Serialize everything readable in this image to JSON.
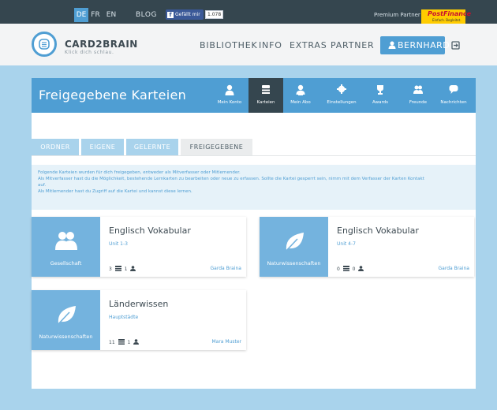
{
  "topbar": {
    "languages": [
      {
        "code": "DE",
        "active": true
      },
      {
        "code": "FR",
        "active": false
      },
      {
        "code": "EN",
        "active": false
      }
    ],
    "blog_label": "BLOG",
    "facebook": {
      "label": "Gefällt mir",
      "count": "1.078"
    },
    "premium_partner_label": "Premium Partner",
    "sponsor": {
      "name": "PostFinance",
      "tagline": "Einfach. Begleitet."
    }
  },
  "header": {
    "brand": "CARD2BRAIN",
    "slogan": "Klick dich schlau.",
    "nav": [
      "BIBLIOTHEK",
      "INFO",
      "EXTRAS",
      "PARTNER"
    ],
    "user_label": "BERNHARD"
  },
  "banner": {
    "title": "Freigegebene Karteien",
    "nav": [
      {
        "label": "Mein Konto",
        "icon": "user-icon",
        "active": false
      },
      {
        "label": "Karteien",
        "icon": "cards-icon",
        "active": true
      },
      {
        "label": "Mein Abo",
        "icon": "subscription-icon",
        "active": false
      },
      {
        "label": "Einstellungen",
        "icon": "gear-icon",
        "active": false
      },
      {
        "label": "Awards",
        "icon": "trophy-icon",
        "active": false
      },
      {
        "label": "Freunde",
        "icon": "friends-icon",
        "active": false
      },
      {
        "label": "Nachrichten",
        "icon": "message-icon",
        "active": false
      }
    ]
  },
  "tabs": [
    {
      "label": "ORDNER",
      "active": false
    },
    {
      "label": "EIGENE",
      "active": false
    },
    {
      "label": "GELERNTE",
      "active": false
    },
    {
      "label": "FREIGEGEBENE",
      "active": true
    }
  ],
  "info_lines": [
    "Folgende Karteien wurden für dich freigegeben, entweder als Mitverfasser oder Mitlernender.",
    "Als Mitverfasser hast du die Möglichkeit, bestehende Lernkarten zu bearbeiten oder neue zu erfassen. Sollte die Kartei gesperrt sein, nimm mit dem Verfasser der Karten Kontakt",
    "auf.",
    "Als Mitlernender hast du Zugriff auf die Kartei und kannst diese lernen."
  ],
  "cards": [
    {
      "category": "Gesellschaft",
      "category_icon": "people-icon",
      "title": "Englisch Vokabular",
      "subtitle": "Unit 1-3",
      "cards_count": "3",
      "users_count": "1",
      "author": "Garda Braina"
    },
    {
      "category": "Naturwissenschaften",
      "category_icon": "leaf-icon",
      "title": "Englisch Vokabular",
      "subtitle": "Unit 4-7",
      "cards_count": "0",
      "users_count": "0",
      "author": "Garda Braina"
    },
    {
      "category": "Naturwissenschaften",
      "category_icon": "leaf-icon",
      "title": "Länderwissen",
      "subtitle": "Hauptstädte",
      "cards_count": "11",
      "users_count": "1",
      "author": "Mara Muster"
    }
  ],
  "colors": {
    "primary": "#4f9ed3",
    "dark": "#35464f",
    "page_bg": "#a9d3ec",
    "category_bg": "#74b3de"
  }
}
